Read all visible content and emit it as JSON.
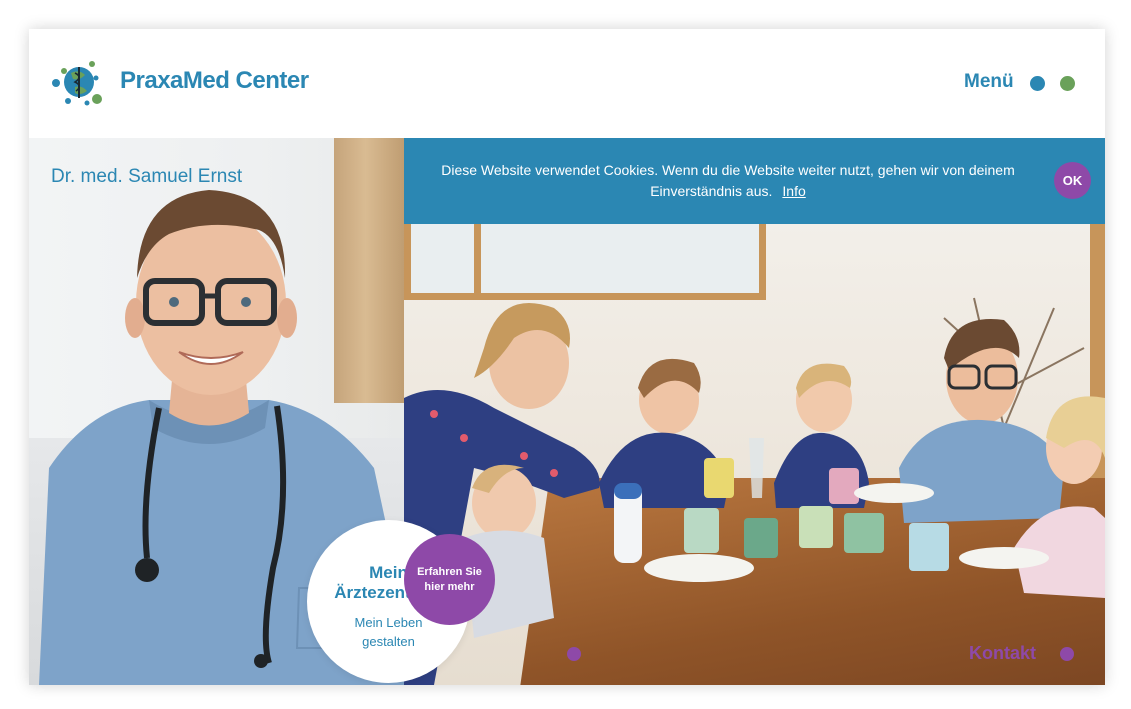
{
  "header": {
    "brand_name": "PraxaMed Center",
    "menu_label": "Menü",
    "logo_icon": "caduceus-globe-icon"
  },
  "hero": {
    "doctor_name": "Dr. med. Samuel Ernst",
    "promo": {
      "title_line1": "Mein",
      "title_line2": "Ärztezentrum",
      "subtitle_line1": "Mein Leben",
      "subtitle_line2": "gestalten"
    },
    "cta": {
      "line1": "Erfahren Sie",
      "line2": "hier mehr"
    }
  },
  "cookie_banner": {
    "text_line1": "Diese Website verwendet Cookies. Wenn du die Website weiter nutzt, gehen wir von deinem",
    "text_line2": "Einverständnis aus.",
    "info_link": "Info",
    "ok_label": "OK"
  },
  "footer": {
    "contact_label": "Kontakt"
  },
  "colors": {
    "primary_blue": "#2b87b3",
    "accent_purple": "#8e49a8",
    "accent_green": "#6aa15a"
  }
}
